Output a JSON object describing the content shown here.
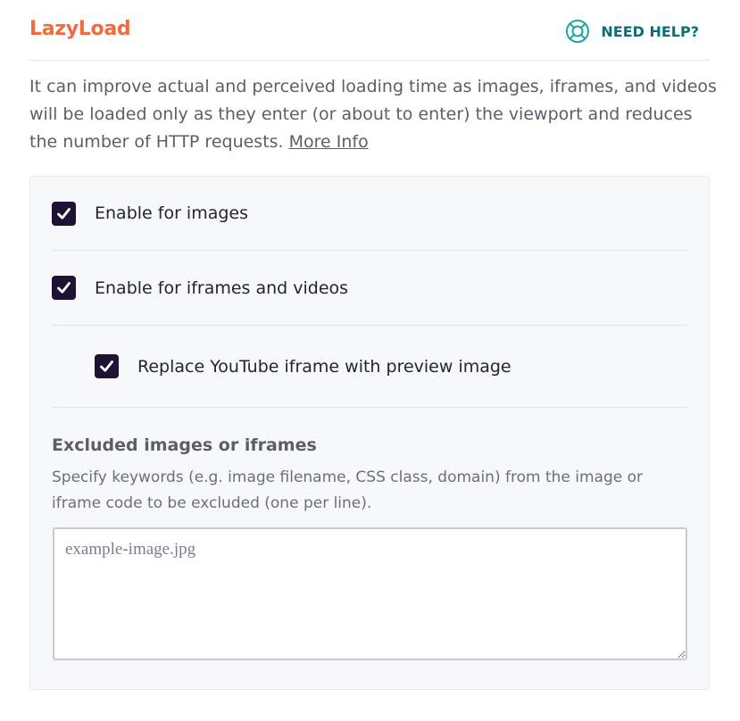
{
  "header": {
    "title": "LazyLoad",
    "help_label": "NEED HELP?",
    "help_icon": "lifebuoy-icon"
  },
  "description": {
    "text": "It can improve actual and perceived loading time as images, iframes, and videos will be loaded only as they enter (or about to enter) the viewport and reduces the number of HTTP requests.",
    "link_label": "More Info"
  },
  "options": [
    {
      "label": "Enable for images",
      "checked": true
    },
    {
      "label": "Enable for iframes and videos",
      "checked": true
    },
    {
      "label": "Replace YouTube iframe with preview image",
      "checked": true
    }
  ],
  "excluded": {
    "title": "Excluded images or iframes",
    "description": "Specify keywords (e.g. image filename, CSS class, domain) from the image or iframe code to be excluded (one per line).",
    "placeholder": "example-image.jpg",
    "value": ""
  },
  "colors": {
    "brand": "#f26a3d",
    "help": "#0e6e77",
    "checkbox": "#1e1235"
  }
}
